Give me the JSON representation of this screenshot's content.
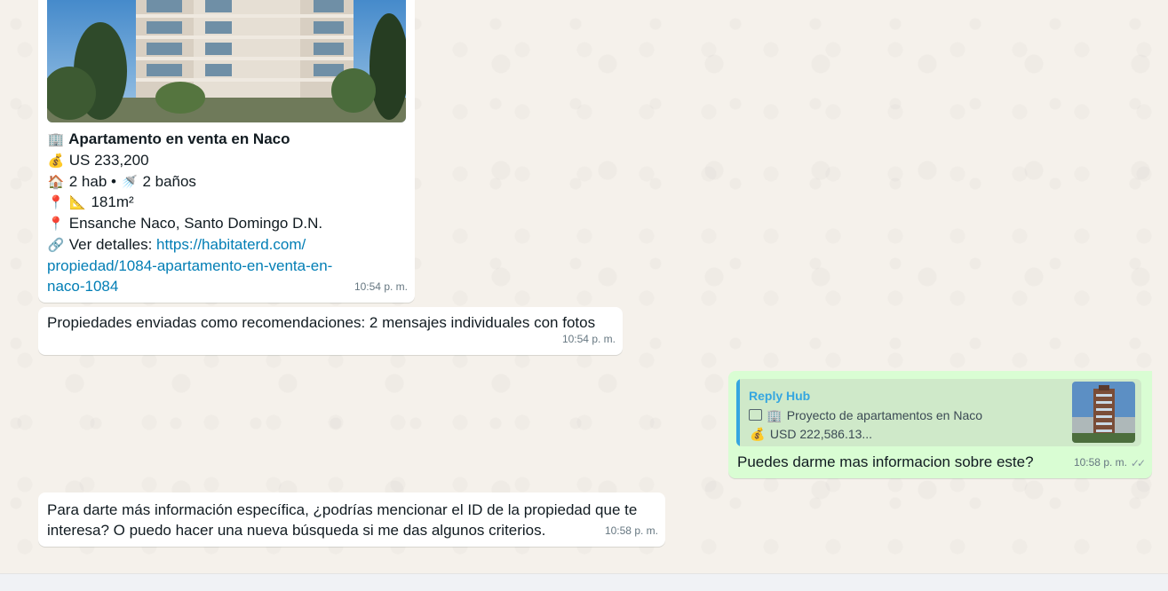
{
  "messages": {
    "property_card": {
      "title": "Apartamento en venta en Naco",
      "price": "US 233,200",
      "rooms": "2 hab",
      "separator": "•",
      "baths": "2 baños",
      "area": "181m²",
      "location": "Ensanche Naco, Santo Domingo D.N.",
      "details_label": "Ver detalles:",
      "link_line1": "https://habitaterd.com/",
      "link_line2": "propiedad/1084-apartamento-en-venta-en-",
      "link_line3": "naco-1084",
      "time": "10:54 p. m."
    },
    "summary": {
      "text": "Propiedades enviadas como recomendaciones: 2 mensajes individuales con fotos",
      "time": "10:54 p. m."
    },
    "outgoing": {
      "quoted_author": "Reply Hub",
      "quoted_title": "Proyecto de apartamentos en Naco",
      "quoted_price": "USD 222,586.13...",
      "text": "Puedes darme mas informacion sobre este?",
      "time": "10:58 p. m."
    },
    "reply": {
      "line1": "Para darte más información específica, ¿podrías mencionar el ID de la propiedad que te",
      "line2": "interesa? O puedo hacer una nueva búsqueda si me das algunos criterios.",
      "time": "10:58 p. m."
    }
  },
  "icons": {
    "building": "building-icon",
    "money_bag": "money-bag-icon",
    "house": "house-icon",
    "shower": "shower-icon",
    "pin": "pin-icon",
    "ruler": "triangular-ruler-icon",
    "link": "link-icon",
    "image": "image-icon",
    "double_check": "double-check-icon"
  },
  "colors": {
    "incoming_bubble": "#ffffff",
    "outgoing_bubble": "#d9fdd3",
    "link": "#027eb5",
    "quote_accent": "#35a6e0",
    "read_ticks": "#8696a0"
  }
}
